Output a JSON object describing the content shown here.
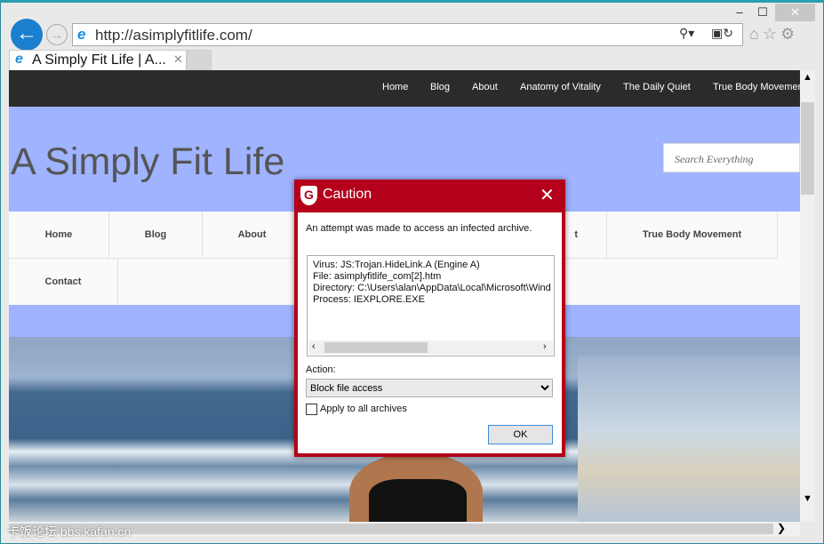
{
  "browser": {
    "url": "http://asimplyfitlife.com/",
    "tab_title": "A Simply Fit Life | A...",
    "window_buttons": [
      "minimize",
      "maximize",
      "close"
    ]
  },
  "site": {
    "top_nav": [
      "Home",
      "Blog",
      "About",
      "Anatomy of Vitality",
      "The Daily Quiet",
      "True Body Movemen"
    ],
    "title": "A Simply Fit Life",
    "search_placeholder": "Search Everything",
    "nav": [
      "Home",
      "Blog",
      "About",
      "t",
      "True Body Movement",
      "Contact"
    ]
  },
  "dialog": {
    "title": "Caution",
    "message": "An attempt was made to access an infected archive.",
    "details": [
      "Virus: JS:Trojan.HideLink.A (Engine A)",
      "File: asimplyfitlife_com[2].htm",
      "Directory: C:\\Users\\alan\\AppData\\Local\\Microsoft\\Wind",
      "Process: IEXPLORE.EXE"
    ],
    "action_label": "Action:",
    "action_value": "Block file access",
    "checkbox_label": "Apply to all archives",
    "checkbox_checked": false,
    "ok_label": "OK",
    "accent": "#b5001b"
  },
  "watermark": "卡饭论坛 bbs.kafan.cn"
}
